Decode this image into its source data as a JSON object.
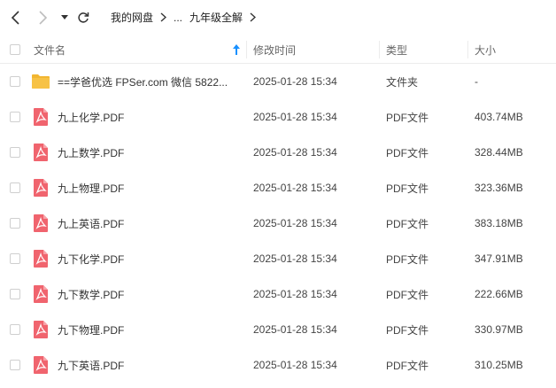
{
  "nav": {
    "back_icon": "chevron-left-icon",
    "forward_icon": "chevron-right-icon",
    "history_icon": "caret-down-icon",
    "refresh_icon": "refresh-icon",
    "breadcrumbs": [
      "我的网盘",
      "...",
      "九年级全解"
    ]
  },
  "columns": {
    "name": "文件名",
    "time": "修改时间",
    "type": "类型",
    "size": "大小",
    "sort_icon": "sort-up-arrow-icon"
  },
  "colors": {
    "accent": "#1890ff",
    "folder": "#f7c245",
    "pdf": "#f0646e"
  },
  "files": [
    {
      "name": "==学爸优选 FPSer.com 微信 5822...",
      "time": "2025-01-28 15:34",
      "type": "文件夹",
      "size": "-",
      "icon": "folder-icon"
    },
    {
      "name": "九上化学.PDF",
      "time": "2025-01-28 15:34",
      "type": "PDF文件",
      "size": "403.74MB",
      "icon": "pdf-icon"
    },
    {
      "name": "九上数学.PDF",
      "time": "2025-01-28 15:34",
      "type": "PDF文件",
      "size": "328.44MB",
      "icon": "pdf-icon"
    },
    {
      "name": "九上物理.PDF",
      "time": "2025-01-28 15:34",
      "type": "PDF文件",
      "size": "323.36MB",
      "icon": "pdf-icon"
    },
    {
      "name": "九上英语.PDF",
      "time": "2025-01-28 15:34",
      "type": "PDF文件",
      "size": "383.18MB",
      "icon": "pdf-icon"
    },
    {
      "name": "九下化学.PDF",
      "time": "2025-01-28 15:34",
      "type": "PDF文件",
      "size": "347.91MB",
      "icon": "pdf-icon"
    },
    {
      "name": "九下数学.PDF",
      "time": "2025-01-28 15:34",
      "type": "PDF文件",
      "size": "222.66MB",
      "icon": "pdf-icon"
    },
    {
      "name": "九下物理.PDF",
      "time": "2025-01-28 15:34",
      "type": "PDF文件",
      "size": "330.97MB",
      "icon": "pdf-icon"
    },
    {
      "name": "九下英语.PDF",
      "time": "2025-01-28 15:34",
      "type": "PDF文件",
      "size": "310.25MB",
      "icon": "pdf-icon"
    }
  ]
}
